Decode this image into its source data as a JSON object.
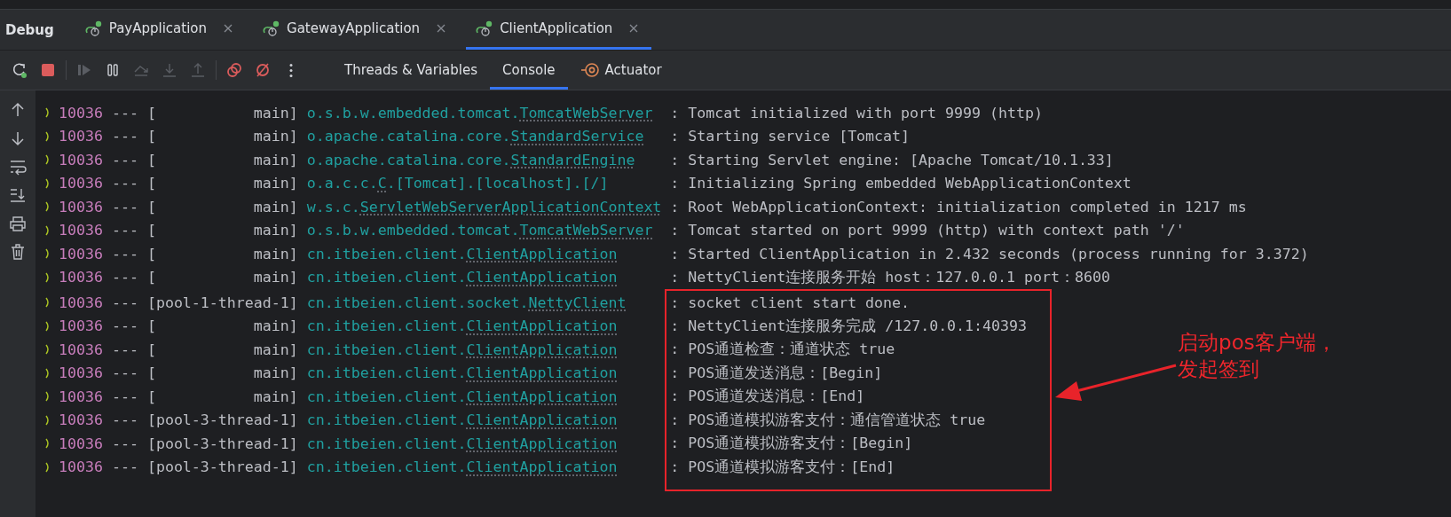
{
  "debug_bar": {
    "title": "Debug",
    "tabs": [
      {
        "label": "PayApplication",
        "selected": false
      },
      {
        "label": "GatewayApplication",
        "selected": false
      },
      {
        "label": "ClientApplication",
        "selected": true
      }
    ]
  },
  "toolbar": {
    "buttons": [
      {
        "kind": "rerun",
        "disabled": false
      },
      {
        "kind": "stop",
        "disabled": false
      },
      {
        "kind": "resume",
        "disabled": true
      },
      {
        "kind": "pause",
        "disabled": false
      },
      {
        "kind": "step_over",
        "disabled": true
      },
      {
        "kind": "step_into",
        "disabled": true
      },
      {
        "kind": "step_out",
        "disabled": true
      },
      {
        "kind": "breakpoints",
        "disabled": false
      },
      {
        "kind": "mute",
        "disabled": false
      },
      {
        "kind": "more",
        "disabled": false
      }
    ],
    "views": [
      {
        "label": "Threads & Variables",
        "kind": "plain",
        "selected": false
      },
      {
        "label": "Console",
        "kind": "plain",
        "selected": true
      },
      {
        "label": "Actuator",
        "kind": "actuator",
        "selected": false
      }
    ]
  },
  "gutter": {
    "buttons": [
      {
        "kind": "up"
      },
      {
        "kind": "down"
      },
      {
        "kind": "wrap"
      },
      {
        "kind": "scroll_end"
      },
      {
        "kind": "print"
      },
      {
        "kind": "clear"
      }
    ]
  },
  "console": {
    "lines": [
      {
        "pid": "10036",
        "separator": "---",
        "thread": "[           main]",
        "package": "o.s.b.w.embedded.tomcat.",
        "class": "TomcatWebServer",
        "message": ": Tomcat initialized with port 9999 (http)"
      },
      {
        "pid": "10036",
        "separator": "---",
        "thread": "[           main]",
        "package": "o.apache.catalina.core.",
        "class": "StandardService",
        "message": ": Starting service [Tomcat]"
      },
      {
        "pid": "10036",
        "separator": "---",
        "thread": "[           main]",
        "package": "o.apache.catalina.core.",
        "class": "StandardEngine",
        "message": ": Starting Servlet engine: [Apache Tomcat/10.1.33]"
      },
      {
        "pid": "10036",
        "separator": "---",
        "thread": "[           main]",
        "package": "o.a.c.c.",
        "class": "C",
        "suffix": ".[Tomcat].[localhost].[/]",
        "message": ": Initializing Spring embedded WebApplicationContext"
      },
      {
        "pid": "10036",
        "separator": "---",
        "thread": "[           main]",
        "package": "w.s.c.",
        "class": "ServletWebServerApplicationContext",
        "message": ": Root WebApplicationContext: initialization completed in 1217 ms"
      },
      {
        "pid": "10036",
        "separator": "---",
        "thread": "[           main]",
        "package": "o.s.b.w.embedded.tomcat.",
        "class": "TomcatWebServer",
        "message": ": Tomcat started on port 9999 (http) with context path '/'"
      },
      {
        "pid": "10036",
        "separator": "---",
        "thread": "[           main]",
        "package": "cn.itbeien.client.",
        "class": "ClientApplication",
        "message": ": Started ClientApplication in 2.432 seconds (process running for 3.372)"
      },
      {
        "pid": "10036",
        "separator": "---",
        "thread": "[           main]",
        "package": "cn.itbeien.client.",
        "class": "ClientApplication",
        "message": ": NettyClient连接服务开始 host：127.0.0.1 port：8600"
      }
    ],
    "callout": {
      "lines": [
        {
          "pid": "10036",
          "separator": "---",
          "thread": "[pool-1-thread-1]",
          "package": "cn.itbeien.client.socket.",
          "class": "NettyClient",
          "message": ": socket client start done."
        },
        {
          "pid": "10036",
          "separator": "---",
          "thread": "[           main]",
          "package": "cn.itbeien.client.",
          "class": "ClientApplication",
          "message": ": NettyClient连接服务完成 /127.0.0.1:40393"
        },
        {
          "pid": "10036",
          "separator": "---",
          "thread": "[           main]",
          "package": "cn.itbeien.client.",
          "class": "ClientApplication",
          "message": ": POS通道检查：通道状态 true"
        },
        {
          "pid": "10036",
          "separator": "---",
          "thread": "[           main]",
          "package": "cn.itbeien.client.",
          "class": "ClientApplication",
          "message": ": POS通道发送消息：[Begin]"
        },
        {
          "pid": "10036",
          "separator": "---",
          "thread": "[           main]",
          "package": "cn.itbeien.client.",
          "class": "ClientApplication",
          "message": ": POS通道发送消息：[End]"
        },
        {
          "pid": "10036",
          "separator": "---",
          "thread": "[pool-3-thread-1]",
          "package": "cn.itbeien.client.",
          "class": "ClientApplication",
          "message": ": POS通道模拟游客支付：通信管道状态 true"
        },
        {
          "pid": "10036",
          "separator": "---",
          "thread": "[pool-3-thread-1]",
          "package": "cn.itbeien.client.",
          "class": "ClientApplication",
          "message": ": POS通道模拟游客支付：[Begin]"
        },
        {
          "pid": "10036",
          "separator": "---",
          "thread": "[pool-3-thread-1]",
          "package": "cn.itbeien.client.",
          "class": "ClientApplication",
          "message": ": POS通道模拟游客支付：[End]"
        }
      ],
      "note": [
        "启动pos客户端，",
        "发起签到"
      ]
    }
  }
}
